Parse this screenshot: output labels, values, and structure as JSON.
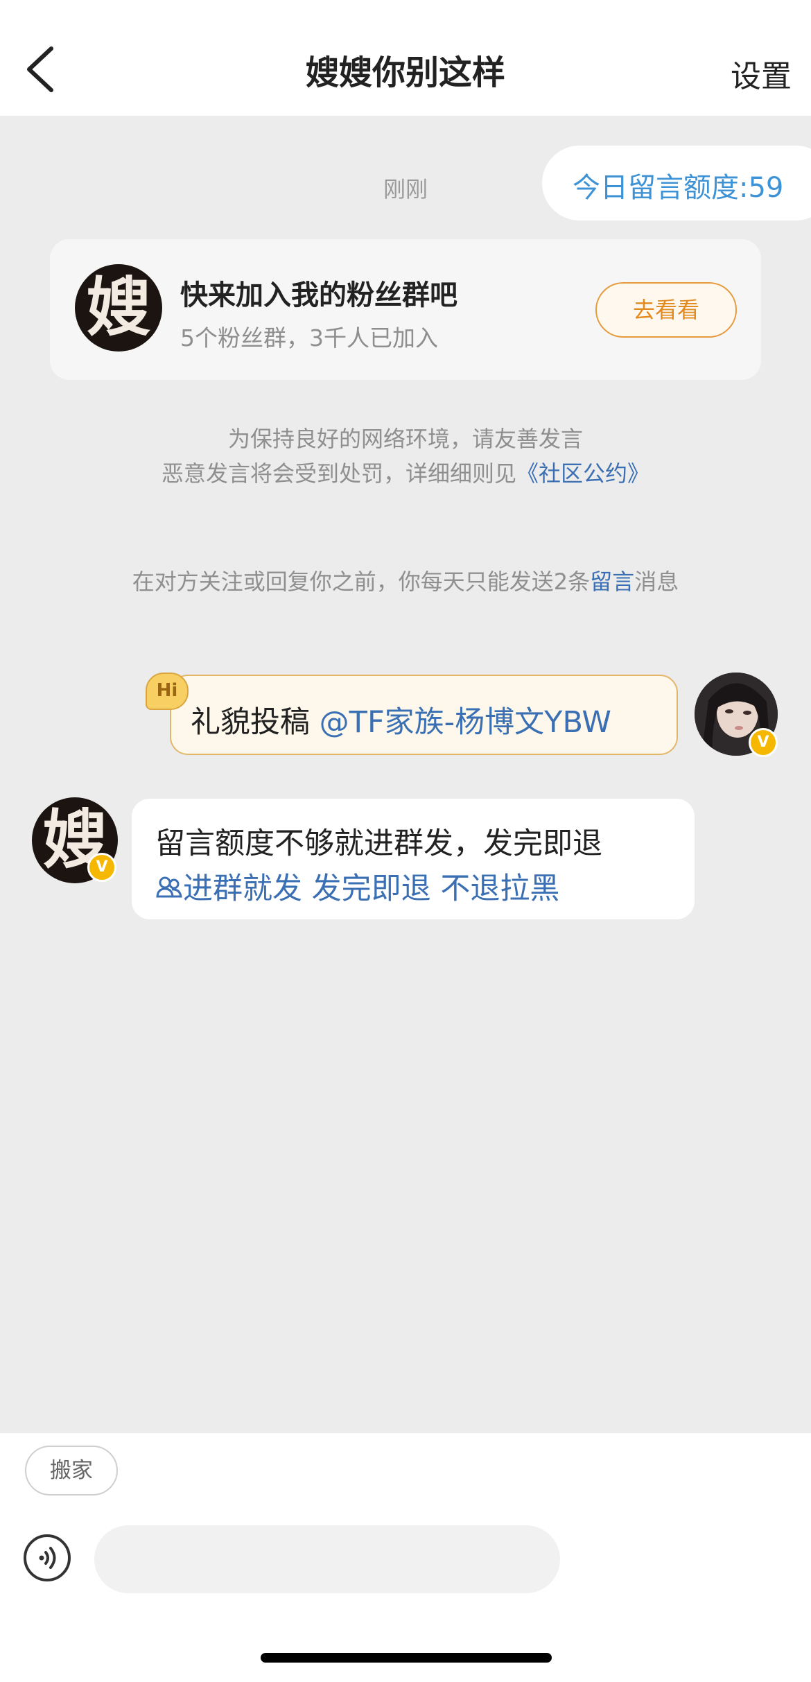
{
  "header": {
    "title": "嫂嫂你别这样",
    "settings_label": "设置"
  },
  "quota": {
    "text": "今日留言额度:59"
  },
  "chat": {
    "timestamp": "刚刚",
    "fan_card": {
      "avatar_char": "嫂",
      "title": "快来加入我的粉丝群吧",
      "subtitle": "5个粉丝群，3千人已加入",
      "button_label": "去看看"
    },
    "notice": {
      "line1": "为保持良好的网络环境，请友善发言",
      "line2_prefix": "恶意发言将会受到处罚，详细细则见",
      "line2_link": "《社区公约》",
      "limit_prefix": "在对方关注或回复你之前，你每天只能发送2条",
      "limit_link": "留言",
      "limit_suffix": "消息"
    },
    "messages": [
      {
        "direction": "outgoing",
        "badge": "Hi",
        "text": "礼貌投稿 ",
        "mention": "@TF家族-杨博文YBW"
      },
      {
        "direction": "incoming",
        "avatar_char": "嫂",
        "line1": "留言额度不够就进群发，发完即退",
        "line2": "进群就发 发完即退 不退拉黑"
      }
    ]
  },
  "verified_badge": "V",
  "bottom": {
    "move_label": "搬家",
    "input_placeholder": ""
  },
  "colors": {
    "link": "#3b6fb4",
    "accent_orange": "#e08a20",
    "quota_blue": "#3d93d6",
    "background": "#ececec"
  },
  "icons": [
    "back-icon",
    "voice-icon",
    "group-link-icon",
    "verified-icon",
    "hi-icon"
  ]
}
